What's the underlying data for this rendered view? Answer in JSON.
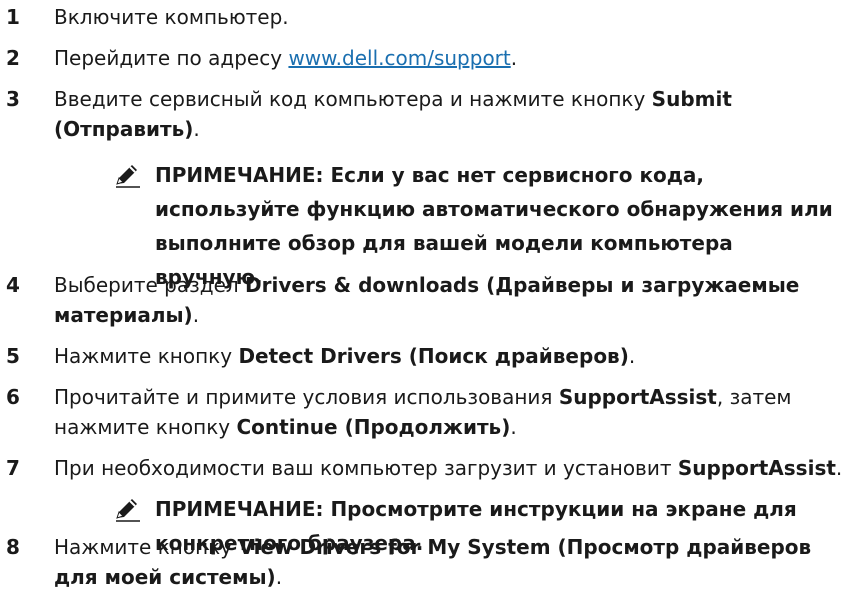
{
  "steps": [
    {
      "num": "1",
      "text": "Включите компьютер."
    },
    {
      "num": "2",
      "pre": "Перейдите по адресу ",
      "link": "www.dell.com/support",
      "post": "."
    },
    {
      "num": "3",
      "pre": "Введите сервисный код компьютера и нажмите кнопку ",
      "bold": "Submit (Отправить)",
      "post": "."
    },
    {
      "num": "4",
      "pre": "Выберите раздел ",
      "bold": "Drivers & downloads (Драйверы и загружаемые материалы)",
      "post": "."
    },
    {
      "num": "5",
      "pre": "Нажмите кнопку ",
      "bold": "Detect Drivers (Поиск драйверов)",
      "post": "."
    },
    {
      "num": "6",
      "pre": "Прочитайте и примите условия использования ",
      "bold": "SupportAssist",
      "mid": ", затем нажмите кнопку ",
      "bold2": "Continue (Продолжить)",
      "post": "."
    },
    {
      "num": "7",
      "pre": "При необходимости ваш компьютер загрузит и установит ",
      "bold": "SupportAssist",
      "post": "."
    },
    {
      "num": "8",
      "pre": "Нажмите кнопку ",
      "bold": "View Drivers for My System (Просмотр драйверов для моей системы)",
      "post": "."
    }
  ],
  "notes": [
    {
      "icon": "pencil-note-icon",
      "text": "ПРИМЕЧАНИЕ: Если у вас нет сервисного кода, используйте функцию автоматического обнаружения или выполните обзор для вашей модели компьютера вручную."
    },
    {
      "icon": "pencil-note-icon",
      "text": "ПРИМЕЧАНИЕ: Просмотрите инструкции на экране для конкретного браузера."
    }
  ],
  "colors": {
    "text": "#1a1a1a",
    "link": "#1a6fb0"
  }
}
